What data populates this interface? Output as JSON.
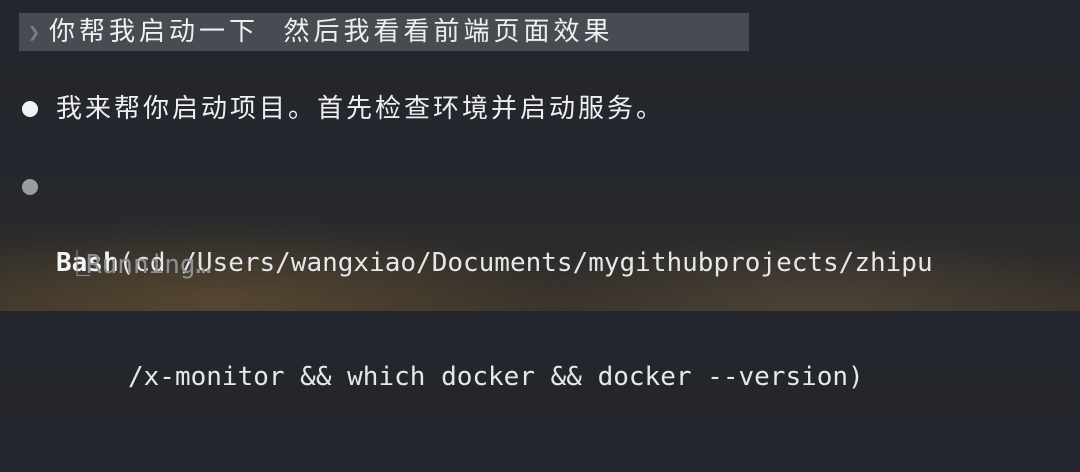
{
  "prompt": {
    "chevron": "❯",
    "text": "你帮我启动一下  然后我看看前端页面效果"
  },
  "assistant_message": {
    "text": "我来帮你启动项目。首先检查环境并启动服务。"
  },
  "tool_call": {
    "name": "Bash",
    "line1": "(cd /Users/wangxiao/Documents/mygithubprojects/zhipu",
    "line2": "/x-monitor && which docker && docker --version)"
  },
  "status": {
    "glyph": "⎿",
    "text": "Running…"
  }
}
